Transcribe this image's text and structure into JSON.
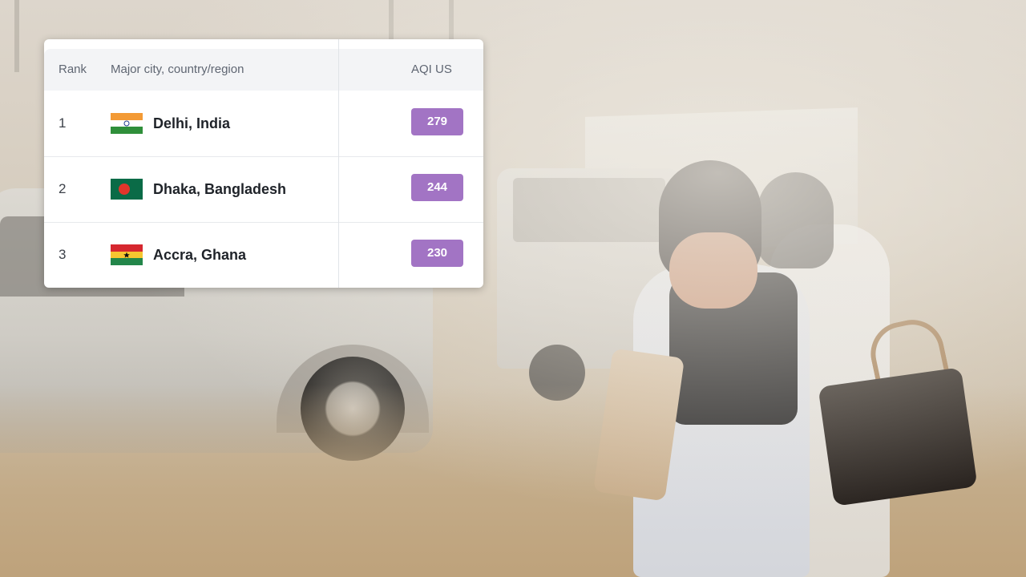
{
  "ranking_table": {
    "headers": {
      "rank": "Rank",
      "city": "Major city, country/region",
      "aqi": "AQI US"
    },
    "rows": [
      {
        "rank": "1",
        "city": "Delhi, India",
        "flag": "india-flag",
        "aqi": "279",
        "aqi_color": "#a274c4"
      },
      {
        "rank": "2",
        "city": "Dhaka, Bangladesh",
        "flag": "bangladesh-flag",
        "aqi": "244",
        "aqi_color": "#a274c4"
      },
      {
        "rank": "3",
        "city": "Accra, Ghana",
        "flag": "ghana-flag",
        "aqi": "230",
        "aqi_color": "#a274c4"
      }
    ]
  },
  "colors": {
    "aqi_very_unhealthy": "#a274c4",
    "header_bg": "#f3f4f6"
  }
}
